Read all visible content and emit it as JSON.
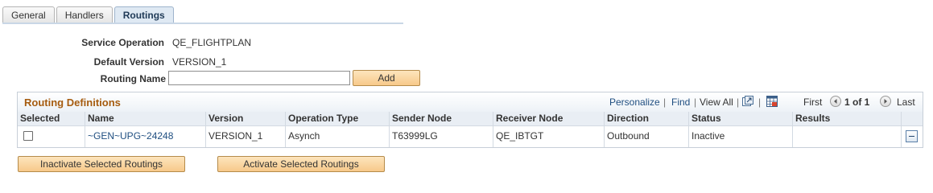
{
  "tabs": [
    {
      "label": "General"
    },
    {
      "label": "Handlers"
    },
    {
      "label": "Routings"
    }
  ],
  "form": {
    "service_operation_label": "Service Operation",
    "service_operation_value": "QE_FLIGHTPLAN",
    "default_version_label": "Default Version",
    "default_version_value": "VERSION_1",
    "routing_name_label": "Routing Name",
    "routing_name_value": "",
    "add_label": "Add"
  },
  "grid": {
    "title": "Routing Definitions",
    "personalize": "Personalize",
    "find": "Find",
    "view_all": "View All",
    "first": "First",
    "range": "1 of 1",
    "last": "Last",
    "columns": [
      "Selected",
      "Name",
      "Version",
      "Operation Type",
      "Sender Node",
      "Receiver Node",
      "Direction",
      "Status",
      "Results"
    ],
    "rows": [
      {
        "selected": false,
        "name": "~GEN~UPG~24248",
        "version": "VERSION_1",
        "operation_type": "Asynch",
        "sender_node": "T63999LG",
        "receiver_node": "QE_IBTGT",
        "direction": "Outbound",
        "status": "Inactive",
        "results": ""
      }
    ]
  },
  "actions": {
    "inactivate_label": "Inactivate Selected Routings",
    "activate_label": "Activate Selected Routings"
  },
  "colors": {
    "grid_title": "#a65c10",
    "link": "#1f4e80",
    "button_fill": "#f7c98a"
  }
}
